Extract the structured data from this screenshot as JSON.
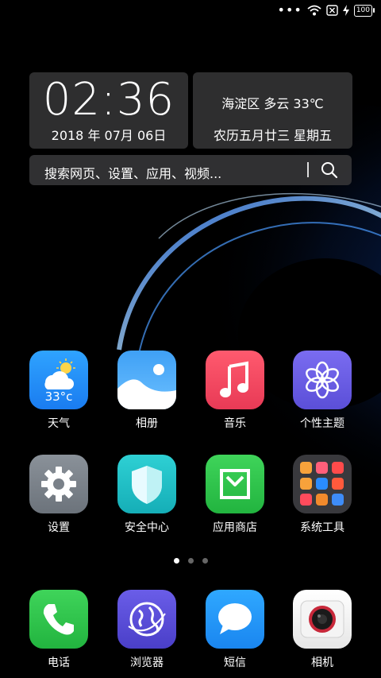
{
  "status_bar": {
    "overflow_dots": "•••",
    "battery_level": "100"
  },
  "clock_widget": {
    "time": "02:36",
    "date": "2018 年 07月 06日"
  },
  "info_widget": {
    "weather": "海淀区 多云 33℃",
    "lunar": "农历五月廿三  星期五"
  },
  "search": {
    "placeholder": "搜索网页、设置、应用、视频..."
  },
  "apps": {
    "weather_label": "天气",
    "weather_temp": "33°c",
    "gallery_label": "相册",
    "music_label": "音乐",
    "themes_label": "个性主题",
    "settings_label": "设置",
    "security_label": "安全中心",
    "appstore_label": "应用商店",
    "tools_label": "系统工具"
  },
  "dock": {
    "phone_label": "电话",
    "browser_label": "浏览器",
    "messages_label": "短信",
    "camera_label": "相机"
  },
  "pager": {
    "pages": 3,
    "current": 1
  }
}
